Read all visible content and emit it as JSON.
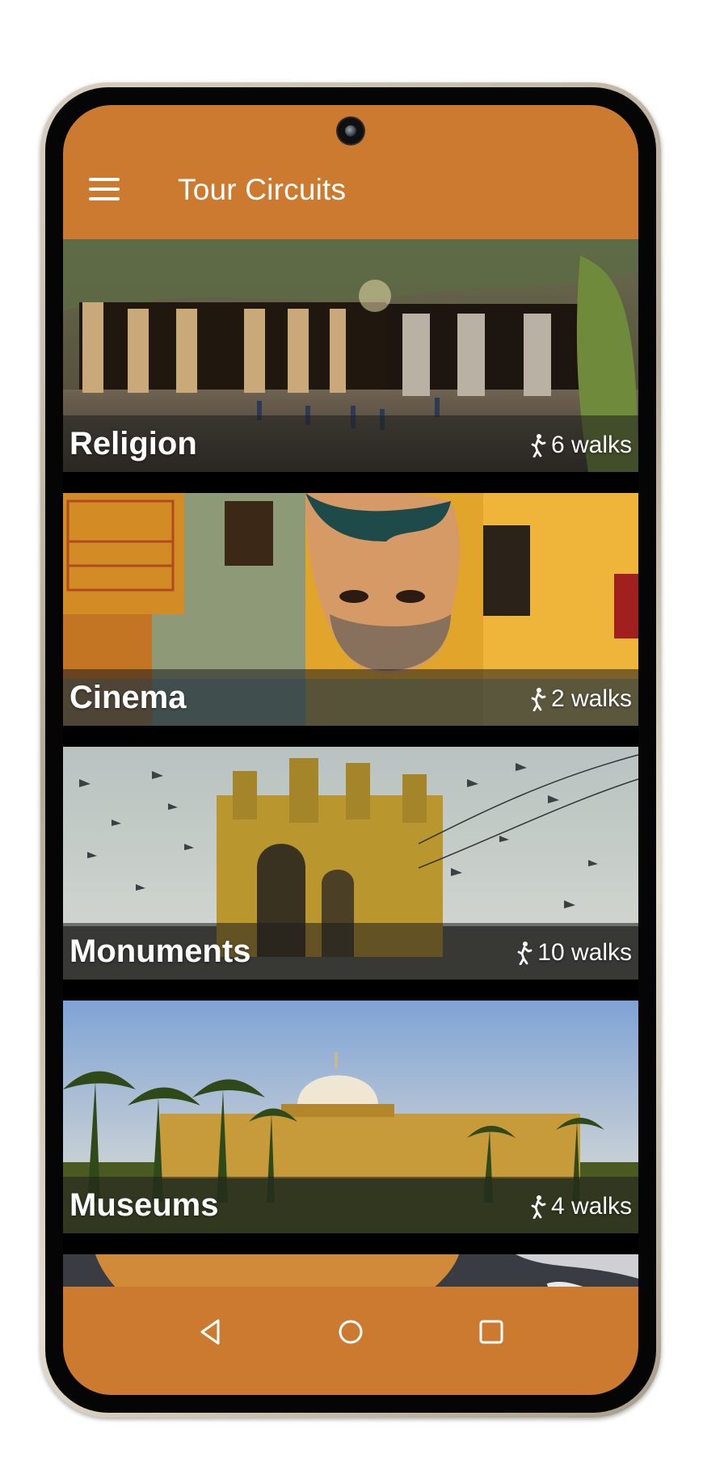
{
  "app": {
    "title": "Tour Circuits",
    "accent_color": "#cc7a30"
  },
  "circuits": [
    {
      "name": "Religion",
      "walks": "6 walks",
      "image": "elephanta-caves-photo"
    },
    {
      "name": "Cinema",
      "walks": "2 walks",
      "image": "street-mural-photo"
    },
    {
      "name": "Monuments",
      "walks": "10 walks",
      "image": "gateway-of-india-photo"
    },
    {
      "name": "Museums",
      "walks": "4 walks",
      "image": "museum-dome-palms-photo"
    },
    {
      "name": "",
      "walks": "",
      "image": "partial-food-photo"
    }
  ],
  "icons": {
    "menu": "hamburger-menu-icon",
    "walk": "walking-person-icon",
    "back": "back-triangle-icon",
    "home": "home-circle-icon",
    "recents": "recents-square-icon"
  }
}
